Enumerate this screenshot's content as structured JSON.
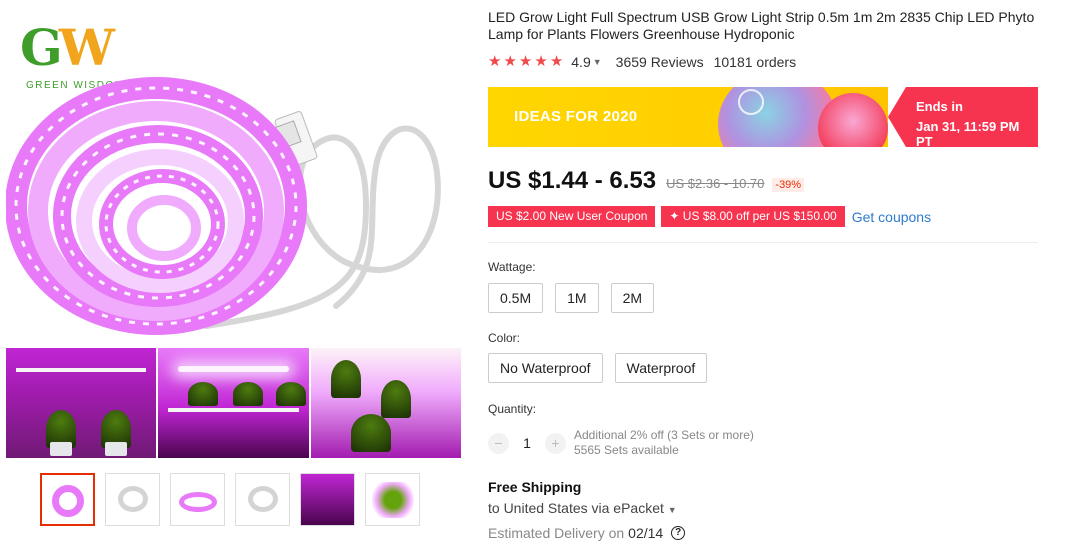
{
  "brand": {
    "logo_letters": "GW",
    "logo_subtitle": "GREEN WISDOM"
  },
  "product": {
    "title": "LED Grow Light Full Spectrum USB Grow Light Strip 0.5m 1m 2m 2835 Chip LED Phyto Lamp for Plants Flowers Greenhouse Hydroponic",
    "rating": "4.9",
    "stars": 5,
    "reviews": "3659 Reviews",
    "orders": "10181 orders"
  },
  "promo_banner": {
    "headline": "IDEAS FOR 2020",
    "ends_label": "Ends in",
    "ends_time": "Jan 31, 11:59 PM PT",
    "colors": {
      "left": "#ffd600",
      "right": "#f6344f"
    }
  },
  "pricing": {
    "price": "US $1.44 - 6.53",
    "original_price": "US $2.36 - 10.70",
    "discount": "-39%"
  },
  "coupons": {
    "new_user": "US $2.00 New User Coupon",
    "store": "✦ US $8.00 off per US $150.00",
    "get_coupons": "Get coupons"
  },
  "options": {
    "wattage_label": "Wattage:",
    "wattage": [
      "0.5M",
      "1M",
      "2M"
    ],
    "color_label": "Color:",
    "color": [
      "No Waterproof",
      "Waterproof"
    ]
  },
  "quantity": {
    "label": "Quantity:",
    "value": "1",
    "minus": "−",
    "plus": "+",
    "offer": "Additional 2% off (3 Sets or more)",
    "available": "5565 Sets available"
  },
  "shipping": {
    "title": "Free Shipping",
    "via": "to United States via ePacket",
    "delivery_label": "Estimated Delivery on",
    "delivery_date": "02/14"
  },
  "icons": {
    "star": "★",
    "chevron": "⌄",
    "help": "?"
  }
}
